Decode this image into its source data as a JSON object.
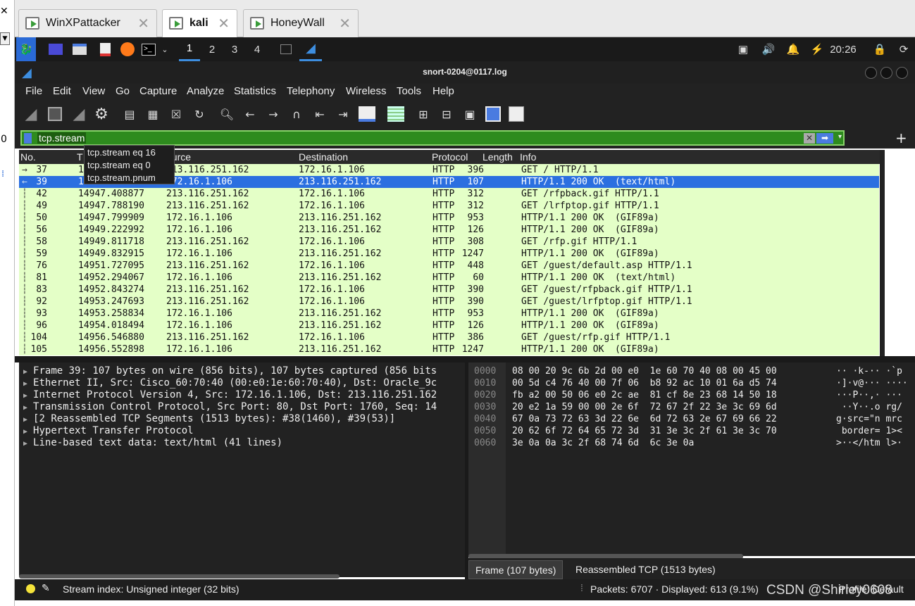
{
  "vm_tabs": [
    {
      "label": "WinXPattacker",
      "active": false
    },
    {
      "label": "kali",
      "active": true
    },
    {
      "label": "HoneyWall",
      "active": false
    }
  ],
  "taskbar": {
    "workspaces": [
      "1",
      "2",
      "3",
      "4"
    ],
    "active_workspace": "1",
    "clock": "20:26"
  },
  "window": {
    "title": "snort-0204@0117.log"
  },
  "menu": [
    "File",
    "Edit",
    "View",
    "Go",
    "Capture",
    "Analyze",
    "Statistics",
    "Telephony",
    "Wireless",
    "Tools",
    "Help"
  ],
  "filter": {
    "value": "tcp.stream",
    "autocomplete": [
      "tcp.stream eq 16",
      "tcp.stream eq 0",
      "tcp.stream.pnum"
    ]
  },
  "packet_list": {
    "columns": [
      "No.",
      "T",
      "ource",
      "Destination",
      "Protocol",
      "Length",
      "Info"
    ],
    "rows": [
      {
        "no": "37",
        "time": "1",
        "src": "213.116.251.162",
        "dst": "172.16.1.106",
        "proto": "HTTP",
        "len": "396",
        "info": "GET / HTTP/1.1"
      },
      {
        "no": "39",
        "time": "1",
        "src": "172.16.1.106",
        "dst": "213.116.251.162",
        "proto": "HTTP",
        "len": "107",
        "info": "HTTP/1.1 200 OK  (text/html)",
        "selected": true
      },
      {
        "no": "42",
        "time": "14947.408877",
        "src": "213.116.251.162",
        "dst": "172.16.1.106",
        "proto": "HTTP",
        "len": "312",
        "info": "GET /rfpback.gif HTTP/1.1"
      },
      {
        "no": "49",
        "time": "14947.788190",
        "src": "213.116.251.162",
        "dst": "172.16.1.106",
        "proto": "HTTP",
        "len": "312",
        "info": "GET /lrfptop.gif HTTP/1.1"
      },
      {
        "no": "50",
        "time": "14947.799909",
        "src": "172.16.1.106",
        "dst": "213.116.251.162",
        "proto": "HTTP",
        "len": "953",
        "info": "HTTP/1.1 200 OK  (GIF89a)"
      },
      {
        "no": "56",
        "time": "14949.222992",
        "src": "172.16.1.106",
        "dst": "213.116.251.162",
        "proto": "HTTP",
        "len": "126",
        "info": "HTTP/1.1 200 OK  (GIF89a)"
      },
      {
        "no": "58",
        "time": "14949.811718",
        "src": "213.116.251.162",
        "dst": "172.16.1.106",
        "proto": "HTTP",
        "len": "308",
        "info": "GET /rfp.gif HTTP/1.1"
      },
      {
        "no": "59",
        "time": "14949.832915",
        "src": "172.16.1.106",
        "dst": "213.116.251.162",
        "proto": "HTTP",
        "len": "1247",
        "info": "HTTP/1.1 200 OK  (GIF89a)"
      },
      {
        "no": "76",
        "time": "14951.727095",
        "src": "213.116.251.162",
        "dst": "172.16.1.106",
        "proto": "HTTP",
        "len": "448",
        "info": "GET /guest/default.asp HTTP/1.1"
      },
      {
        "no": "81",
        "time": "14952.294067",
        "src": "172.16.1.106",
        "dst": "213.116.251.162",
        "proto": "HTTP",
        "len": "60",
        "info": "HTTP/1.1 200 OK  (text/html)"
      },
      {
        "no": "83",
        "time": "14952.843274",
        "src": "213.116.251.162",
        "dst": "172.16.1.106",
        "proto": "HTTP",
        "len": "390",
        "info": "GET /guest/rfpback.gif HTTP/1.1"
      },
      {
        "no": "92",
        "time": "14953.247693",
        "src": "213.116.251.162",
        "dst": "172.16.1.106",
        "proto": "HTTP",
        "len": "390",
        "info": "GET /guest/lrfptop.gif HTTP/1.1"
      },
      {
        "no": "93",
        "time": "14953.258834",
        "src": "172.16.1.106",
        "dst": "213.116.251.162",
        "proto": "HTTP",
        "len": "953",
        "info": "HTTP/1.1 200 OK  (GIF89a)"
      },
      {
        "no": "96",
        "time": "14954.018494",
        "src": "172.16.1.106",
        "dst": "213.116.251.162",
        "proto": "HTTP",
        "len": "126",
        "info": "HTTP/1.1 200 OK  (GIF89a)"
      },
      {
        "no": "104",
        "time": "14956.546880",
        "src": "213.116.251.162",
        "dst": "172.16.1.106",
        "proto": "HTTP",
        "len": "386",
        "info": "GET /guest/rfp.gif HTTP/1.1"
      },
      {
        "no": "105",
        "time": "14956.552898",
        "src": "172.16.1.106",
        "dst": "213.116.251.162",
        "proto": "HTTP",
        "len": "1247",
        "info": "HTTP/1.1 200 OK  (GIF89a)"
      }
    ]
  },
  "details": [
    "Frame 39: 107 bytes on wire (856 bits), 107 bytes captured (856 bits",
    "Ethernet II, Src: Cisco_60:70:40 (00:e0:1e:60:70:40), Dst: Oracle_9c",
    "Internet Protocol Version 4, Src: 172.16.1.106, Dst: 213.116.251.162",
    "Transmission Control Protocol, Src Port: 80, Dst Port: 1760, Seq: 14",
    "[2 Reassembled TCP Segments (1513 bytes): #38(1460), #39(53)]",
    "Hypertext Transfer Protocol",
    "Line-based text data: text/html (41 lines)"
  ],
  "hex": [
    {
      "off": "0000",
      "bytes": "08 00 20 9c 6b 2d 00 e0  1e 60 70 40 08 00 45 00",
      "ascii": "·· ·k-·· ·`p"
    },
    {
      "off": "0010",
      "bytes": "00 5d c4 76 40 00 7f 06  b8 92 ac 10 01 6a d5 74",
      "ascii": "·]·v@··· ····"
    },
    {
      "off": "0020",
      "bytes": "fb a2 00 50 06 e0 2c ae  81 cf 8e 23 68 14 50 18",
      "ascii": "···P··,· ···"
    },
    {
      "off": "0030",
      "bytes": "20 e2 1a 59 00 00 2e 6f  72 67 2f 22 3e 3c 69 6d",
      "ascii": " ··Y··.o rg/"
    },
    {
      "off": "0040",
      "bytes": "67 0a 73 72 63 3d 22 6e  6d 72 63 2e 67 69 66 22",
      "ascii": "g·src=\"n mrc"
    },
    {
      "off": "0050",
      "bytes": "20 62 6f 72 64 65 72 3d  31 3e 3c 2f 61 3e 3c 70",
      "ascii": " border= 1><"
    },
    {
      "off": "0060",
      "bytes": "3e 0a 0a 3c 2f 68 74 6d  6c 3e 0a",
      "ascii": ">··</htm l>·"
    }
  ],
  "byte_tabs": [
    "Frame (107 bytes)",
    "Reassembled TCP (1513 bytes)"
  ],
  "status": {
    "field": "Stream index: Unsigned integer (32 bits)",
    "packets": "Packets: 6707 · Displayed: 613 (9.1%)",
    "profile": "Profile: Default"
  },
  "watermark": "CSDN @Shirley0608",
  "left_strip": {
    "zero": "0"
  }
}
